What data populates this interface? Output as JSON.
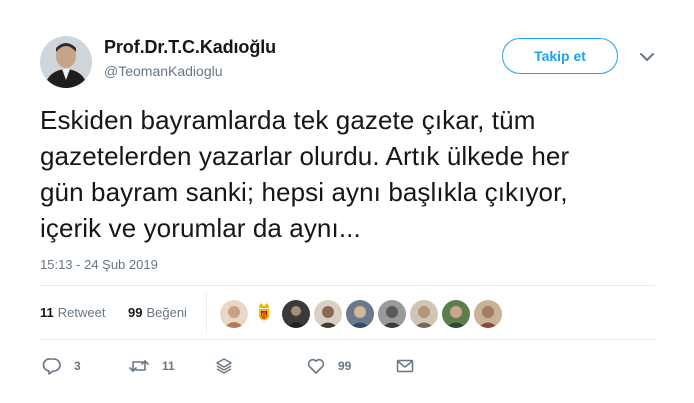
{
  "author": {
    "name": "Prof.Dr.T.C.Kadıoğlu",
    "handle": "@TeomanKadioglu"
  },
  "follow_button": {
    "label": "Takip et"
  },
  "tweet": {
    "lines": [
      "Eskiden bayramlarda tek gazete çıkar, tüm",
      "gazetelerden yazarlar olurdu. Artık ülkede her",
      "gün bayram sanki; hepsi aynı başlıkla çıkıyor,",
      "içerik ve yorumlar da aynı..."
    ],
    "timestamp": "15:13 - 24 Şub 2019"
  },
  "stats": {
    "retweets": {
      "count": "11",
      "label": "Retweet"
    },
    "likes": {
      "count": "99",
      "label": "Beğeni"
    }
  },
  "actions": {
    "reply_count": "3",
    "retweet_count": "11",
    "like_count": "99"
  },
  "colors": {
    "accent": "#1da1f2",
    "secondary_text": "#657786",
    "divider": "#e6ecf0"
  },
  "icons": [
    "chevron-down-icon",
    "reply-icon",
    "retweet-icon",
    "stack-icon",
    "heart-icon",
    "mail-icon"
  ]
}
